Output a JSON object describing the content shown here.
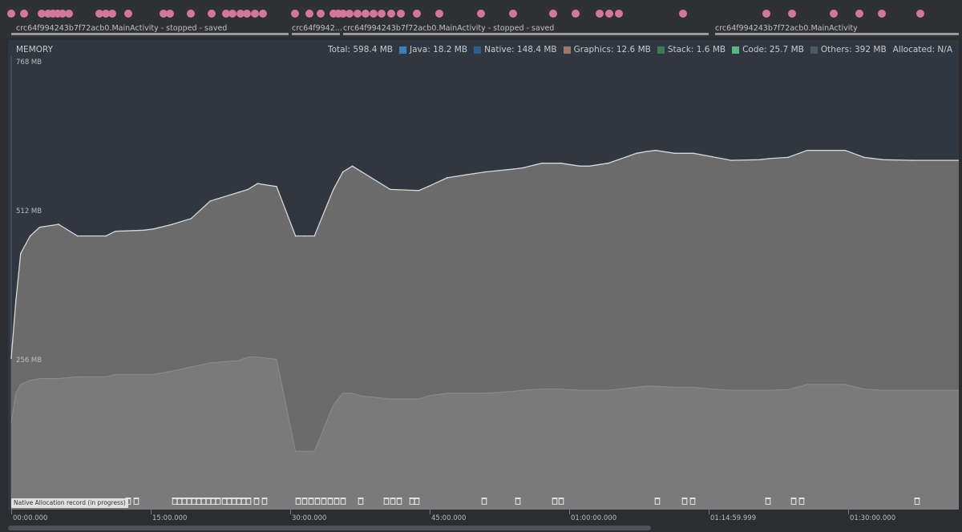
{
  "activities": [
    {
      "label": "crc64f994243b7f72acb0.MainActivity - stopped - saved"
    },
    {
      "label": "crc64f9942..."
    },
    {
      "label": "crc64f994243b7f72acb0.MainActivity - stopped - saved"
    },
    {
      "label": "crc64f994243b7f72acb0.MainActivity"
    }
  ],
  "memory": {
    "title": "MEMORY",
    "legend": [
      {
        "label": "Total: 598.4 MB",
        "color": null
      },
      {
        "label": "Java: 18.2 MB",
        "color": "#3f7fb8"
      },
      {
        "label": "Native: 148.4 MB",
        "color": "#2c5f8a"
      },
      {
        "label": "Graphics: 12.6 MB",
        "color": "#a0786a"
      },
      {
        "label": "Stack: 1.6 MB",
        "color": "#3c7a5a"
      },
      {
        "label": "Code: 25.7 MB",
        "color": "#55b88a"
      },
      {
        "label": "Others: 392 MB",
        "color": "#4d5860"
      },
      {
        "label": "Allocated: N/A",
        "color": null
      }
    ],
    "y_ticks": [
      "768 MB",
      "512 MB",
      "256 MB"
    ]
  },
  "status_badge": "Native Allocation record (in progress)",
  "timeline": {
    "ticks": [
      "00:00.000",
      "15:00.000",
      "30:00.000",
      "45:00.000",
      "01:00:00.000",
      "01:14:59.999",
      "01:30:00.000"
    ]
  },
  "colors": {
    "background": "#2b2d30",
    "chart_bg": "#313740",
    "area_fill": "#6e6e6e",
    "total_line": "#d8d8d8",
    "event_dot": "#d4789a"
  },
  "chart_data": {
    "type": "area",
    "xlabel": "",
    "ylabel": "",
    "y_unit": "MB",
    "ylim": [
      0,
      768
    ],
    "x_unit": "minutes",
    "xlim": [
      0,
      100
    ],
    "series": [
      {
        "name": "Total",
        "x": [
          0,
          0.5,
          1,
          2,
          3,
          5,
          7,
          10,
          11,
          14,
          15,
          17,
          19,
          21,
          24,
          25,
          26,
          28,
          30,
          31,
          32,
          34,
          35,
          36,
          37,
          40,
          43,
          44,
          46,
          48,
          50,
          53,
          54,
          56,
          58,
          60,
          61,
          63,
          66,
          67,
          68,
          70,
          72,
          74,
          76,
          79,
          80,
          82,
          84,
          88,
          90,
          92,
          95,
          100
        ],
        "values": [
          260,
          360,
          440,
          470,
          485,
          490,
          470,
          470,
          478,
          480,
          482,
          490,
          500,
          530,
          545,
          550,
          560,
          555,
          470,
          470,
          470,
          550,
          580,
          590,
          580,
          550,
          548,
          555,
          570,
          575,
          580,
          585,
          587,
          595,
          595,
          590,
          590,
          595,
          612,
          615,
          617,
          612,
          612,
          606,
          600,
          601,
          603,
          605,
          617,
          617,
          605,
          601,
          600,
          600
        ]
      },
      {
        "name": "Others",
        "x": [
          0,
          0.5,
          1,
          2,
          3,
          5,
          7,
          10,
          11,
          14,
          15,
          17,
          19,
          21,
          24,
          25,
          26,
          28,
          30,
          31,
          32,
          34,
          35,
          36,
          37,
          40,
          43,
          44,
          46,
          48,
          50,
          53,
          54,
          56,
          58,
          60,
          61,
          63,
          66,
          67,
          68,
          70,
          72,
          74,
          76,
          79,
          80,
          82,
          84,
          88,
          90,
          92,
          95,
          100
        ],
        "values": [
          150,
          200,
          215,
          222,
          225,
          225,
          228,
          228,
          232,
          232,
          232,
          238,
          245,
          252,
          256,
          262,
          262,
          258,
          100,
          100,
          100,
          180,
          200,
          200,
          195,
          190,
          190,
          195,
          200,
          200,
          200,
          203,
          205,
          207,
          207,
          205,
          205,
          205,
          210,
          212,
          212,
          210,
          210,
          207,
          205,
          205,
          205,
          206,
          215,
          215,
          207,
          205,
          205,
          205
        ]
      }
    ],
    "legend_position": "top-right"
  }
}
